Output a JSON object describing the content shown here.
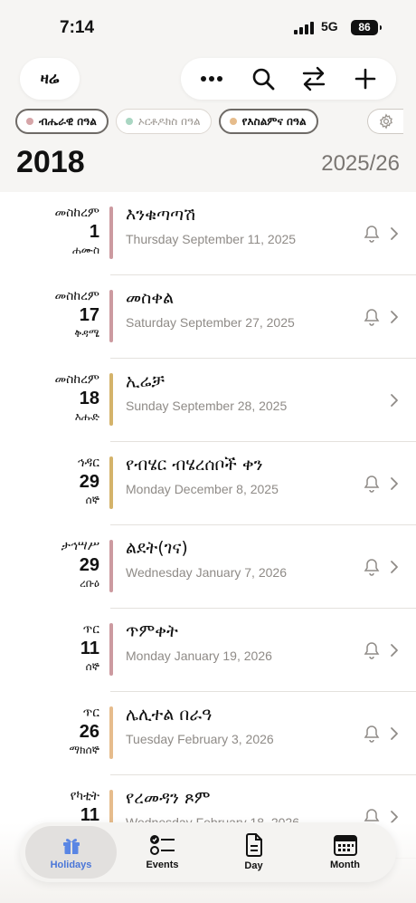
{
  "status": {
    "time": "7:14",
    "network": "5G",
    "battery": "86"
  },
  "header": {
    "today_label": "ዛሬ",
    "actions": [
      "more-icon",
      "search-icon",
      "swap-icon",
      "add-icon"
    ],
    "chips": [
      {
        "label": "ብሔራዊ በዓል",
        "color": "#d6a5a8",
        "selected": true
      },
      {
        "label": "ኦርቶዶክስ በዓል",
        "color": "#a9d6c2",
        "selected": false
      },
      {
        "label": "የእስልምና በዓል",
        "color": "#e6bc8c",
        "selected": true
      }
    ],
    "year": "2018",
    "gregorian_year": "2025/26"
  },
  "holidays": [
    {
      "month": "መስከረም",
      "day": "1",
      "weekday": "ሐሙስ",
      "title": "እንቁጣጣሽ",
      "date": "Thursday September 11, 2025",
      "color": "#cc9aa0",
      "bell": true
    },
    {
      "month": "መስከረም",
      "day": "17",
      "weekday": "ቅዳሜ",
      "title": "መስቀል",
      "date": "Saturday September 27, 2025",
      "color": "#cc9aa0",
      "bell": true
    },
    {
      "month": "መስከረም",
      "day": "18",
      "weekday": "እሑድ",
      "title": "ኢሬቻ",
      "date": "Sunday September 28, 2025",
      "color": "#d4b36a",
      "bell": false
    },
    {
      "month": "ኅዳር",
      "day": "29",
      "weekday": "ሰኞ",
      "title": "የብሄር ብሄረሰቦች ቀን",
      "date": "Monday December 8, 2025",
      "color": "#d4b36a",
      "bell": true
    },
    {
      "month": "ታኅሣሥ",
      "day": "29",
      "weekday": "ረቡዕ",
      "title": "ልደት(ገና)",
      "date": "Wednesday January 7, 2026",
      "color": "#cc9aa0",
      "bell": true
    },
    {
      "month": "ጥር",
      "day": "11",
      "weekday": "ሰኞ",
      "title": "ጥምቀት",
      "date": "Monday January 19, 2026",
      "color": "#cc9aa0",
      "bell": true
    },
    {
      "month": "ጥር",
      "day": "26",
      "weekday": "ማክሰኞ",
      "title": "ሌሊተል በራዓ",
      "date": "Tuesday February 3, 2026",
      "color": "#e6bc8c",
      "bell": true
    },
    {
      "month": "የካቲት",
      "day": "11",
      "weekday": "",
      "title": "የረመዳን ጾም",
      "date": "Wednesday February 18, 2026",
      "color": "#e6bc8c",
      "bell": true
    }
  ],
  "tabs": [
    {
      "label": "Holidays",
      "icon": "gift-icon",
      "active": true
    },
    {
      "label": "Events",
      "icon": "checklist-icon",
      "active": false
    },
    {
      "label": "Day",
      "icon": "document-icon",
      "active": false
    },
    {
      "label": "Month",
      "icon": "calendar-icon",
      "active": false
    }
  ]
}
